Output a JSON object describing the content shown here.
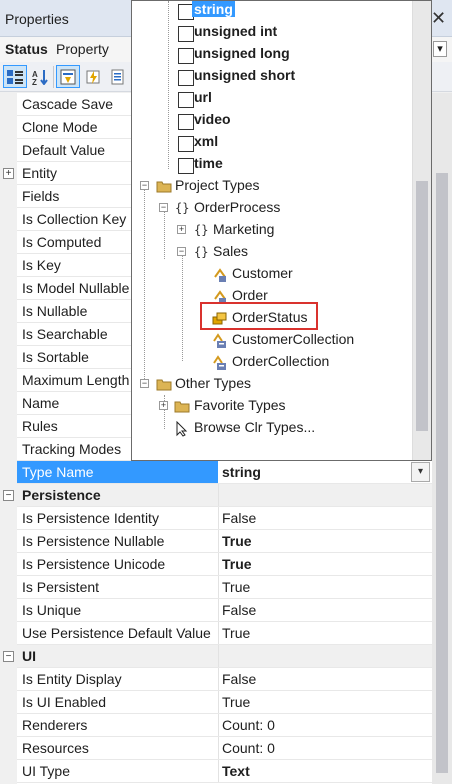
{
  "window": {
    "title": "Properties",
    "close_glyph": "✕"
  },
  "subject": {
    "name": "Status",
    "type": "Property",
    "button_glyph": "▾"
  },
  "toolbar": {
    "buttons": [
      "categorized-icon",
      "alphabetical-icon",
      "properties-icon",
      "events-icon",
      "property-pages-icon"
    ]
  },
  "colors": {
    "accent": "#3399ff",
    "highlight_box": "#d9322e",
    "category_bg": "#f0f0f0"
  },
  "grid": {
    "rows": [
      {
        "name": "Cascade Save"
      },
      {
        "name": "Clone Mode"
      },
      {
        "name": "Default Value"
      },
      {
        "name": "Entity",
        "expander": "+"
      },
      {
        "name": "Fields"
      },
      {
        "name": "Is Collection Key"
      },
      {
        "name": "Is Computed"
      },
      {
        "name": "Is Key"
      },
      {
        "name": "Is Model Nullable"
      },
      {
        "name": "Is Nullable"
      },
      {
        "name": "Is Searchable"
      },
      {
        "name": "Is Sortable"
      },
      {
        "name": "Maximum Length"
      },
      {
        "name": "Name"
      },
      {
        "name": "Rules"
      },
      {
        "name": "Tracking Modes"
      }
    ],
    "selected": {
      "name": "Type Name",
      "value": "string",
      "dropdown_glyph": "▾"
    },
    "persistence": {
      "label": "Persistence",
      "expander": "−",
      "rows": [
        {
          "name": "Is Persistence Identity",
          "value": "False"
        },
        {
          "name": "Is Persistence Nullable",
          "value": "True",
          "bold": true
        },
        {
          "name": "Is Persistence Unicode",
          "value": "True",
          "bold": true
        },
        {
          "name": "Is Persistent",
          "value": "True"
        },
        {
          "name": "Is Unique",
          "value": "False"
        },
        {
          "name": "Use Persistence Default Value",
          "value": "True"
        }
      ]
    },
    "ui": {
      "label": "UI",
      "expander": "−",
      "rows": [
        {
          "name": "Is Entity Display",
          "value": "False"
        },
        {
          "name": "Is UI Enabled",
          "value": "True"
        },
        {
          "name": "Renderers",
          "value": "Count: 0"
        },
        {
          "name": "Resources",
          "value": "Count: 0"
        },
        {
          "name": "UI Type",
          "value": "Text",
          "bold": true
        }
      ]
    }
  },
  "popup": {
    "builtin_types": [
      "string",
      "unsigned int",
      "unsigned long",
      "unsigned short",
      "url",
      "video",
      "xml",
      "time"
    ],
    "selected_builtin": "string",
    "project_types": "Project Types",
    "order_process": "OrderProcess",
    "marketing": "Marketing",
    "sales": "Sales",
    "sales_items": [
      "Customer",
      "Order",
      "OrderStatus",
      "CustomerCollection",
      "OrderCollection"
    ],
    "highlighted_item": "OrderStatus",
    "other_types": "Other Types",
    "favorite_types": "Favorite Types",
    "browse_clr": "Browse Clr Types...",
    "expanded_glyph": "−",
    "collapsed_glyph": "+",
    "namespace_glyph": "{}"
  }
}
